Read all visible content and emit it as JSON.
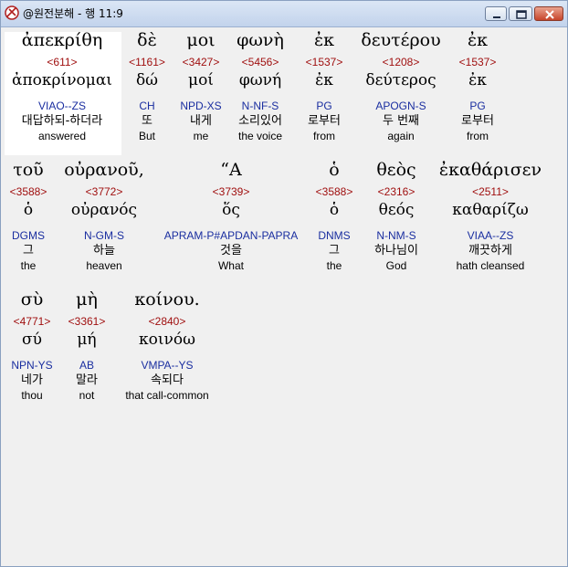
{
  "window": {
    "title": "@원전분해 - 행 11:9"
  },
  "rows": [
    {
      "words": [
        {
          "greek": "ἀπεκρίθη",
          "strong": "<611>",
          "lemma": "ἀποκρίνομαι",
          "parse": "VIAO--ZS",
          "korean": "대답하되-하더라",
          "english": "answered"
        },
        {
          "greek": "δὲ",
          "strong": "<1161>",
          "lemma": "δώ",
          "parse": "CH",
          "korean": "또",
          "english": "But"
        },
        {
          "greek": "μοι",
          "strong": "<3427>",
          "lemma": "μοί",
          "parse": "NPD-XS",
          "korean": "내게",
          "english": "me"
        },
        {
          "greek": "φωνὴ",
          "strong": "<5456>",
          "lemma": "φωνή",
          "parse": "N-NF-S",
          "korean": "소리있어",
          "english": "the voice"
        },
        {
          "greek": "ἐκ",
          "strong": "<1537>",
          "lemma": "ἐκ",
          "parse": "PG",
          "korean": "로부터",
          "english": "from"
        },
        {
          "greek": "δευτέρου",
          "strong": "<1208>",
          "lemma": "δεύτερος",
          "parse": "APOGN-S",
          "korean": "두 번째",
          "english": "again"
        },
        {
          "greek": "ἐκ",
          "strong": "<1537>",
          "lemma": "ἐκ",
          "parse": "PG",
          "korean": "로부터",
          "english": "from"
        }
      ]
    },
    {
      "words": [
        {
          "greek": "τοῦ",
          "strong": "<3588>",
          "lemma": "ὁ",
          "parse": "DGMS",
          "korean": "그",
          "english": "the"
        },
        {
          "greek": "οὐρανοῦ,",
          "strong": "<3772>",
          "lemma": "οὐρανός",
          "parse": "N-GM-S",
          "korean": "하늘",
          "english": "heaven"
        },
        {
          "greek": "“Α",
          "strong": "<3739>",
          "lemma": "ὅς",
          "parse": "APRAM-P#APDAN-PAPRA",
          "korean": "것을",
          "english": "What"
        },
        {
          "greek": "ὁ",
          "strong": "<3588>",
          "lemma": "ὁ",
          "parse": "DNMS",
          "korean": "그",
          "english": "the"
        },
        {
          "greek": "θεὸς",
          "strong": "<2316>",
          "lemma": "θεός",
          "parse": "N-NM-S",
          "korean": "하나님이",
          "english": "God"
        },
        {
          "greek": "ἐκαθάρισεν",
          "strong": "<2511>",
          "lemma": "καθαρίζω",
          "parse": "VIAA--ZS",
          "korean": "깨끗하게",
          "english": "hath cleansed"
        }
      ]
    },
    {
      "words": [
        {
          "greek": "σὺ",
          "strong": "<4771>",
          "lemma": "σύ",
          "parse": "NPN-YS",
          "korean": "네가",
          "english": "thou"
        },
        {
          "greek": "μὴ",
          "strong": "<3361>",
          "lemma": "μή",
          "parse": "AB",
          "korean": "말라",
          "english": "not"
        },
        {
          "greek": "κοίνου.",
          "strong": "<2840>",
          "lemma": "κοινόω",
          "parse": "VMPA--YS",
          "korean": "속되다",
          "english": "that call-common"
        }
      ]
    }
  ]
}
